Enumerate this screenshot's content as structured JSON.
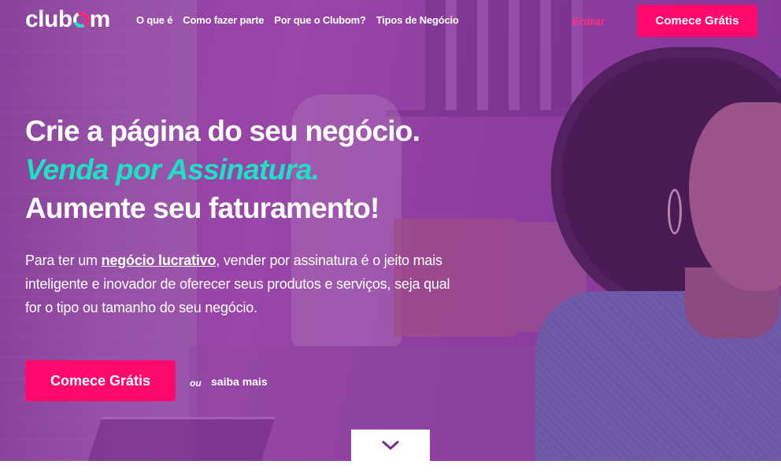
{
  "brand": {
    "logo_text_pre": "club",
    "logo_text_post": "m",
    "accent_pink": "#ff0a6c",
    "accent_teal": "#19e3c5",
    "overlay_purple": "#8d3d9e"
  },
  "nav": {
    "links": [
      "O que é",
      "Como fazer parte",
      "Por que o Clubom?",
      "Tipos de Negócio"
    ],
    "login_label": "Entrar",
    "cta_label": "Comece Grátis"
  },
  "hero": {
    "headline_line1": "Crie a página do seu negócio.",
    "headline_line2": "Venda por Assinatura.",
    "headline_line3": "Aumente seu faturamento!",
    "description_pre": "Para ter um ",
    "description_link": "negócio lucrativo",
    "description_post": ", vender por assinatura é o jeito mais inteligente e inovador de oferecer seus produtos e serviços, seja qual for o tipo ou tamanho do seu negócio.",
    "cta_label": "Comece Grátis",
    "or_label": "ou",
    "learn_more_label": "saiba mais"
  },
  "icons": {
    "scroll": "chevron-down-icon"
  }
}
